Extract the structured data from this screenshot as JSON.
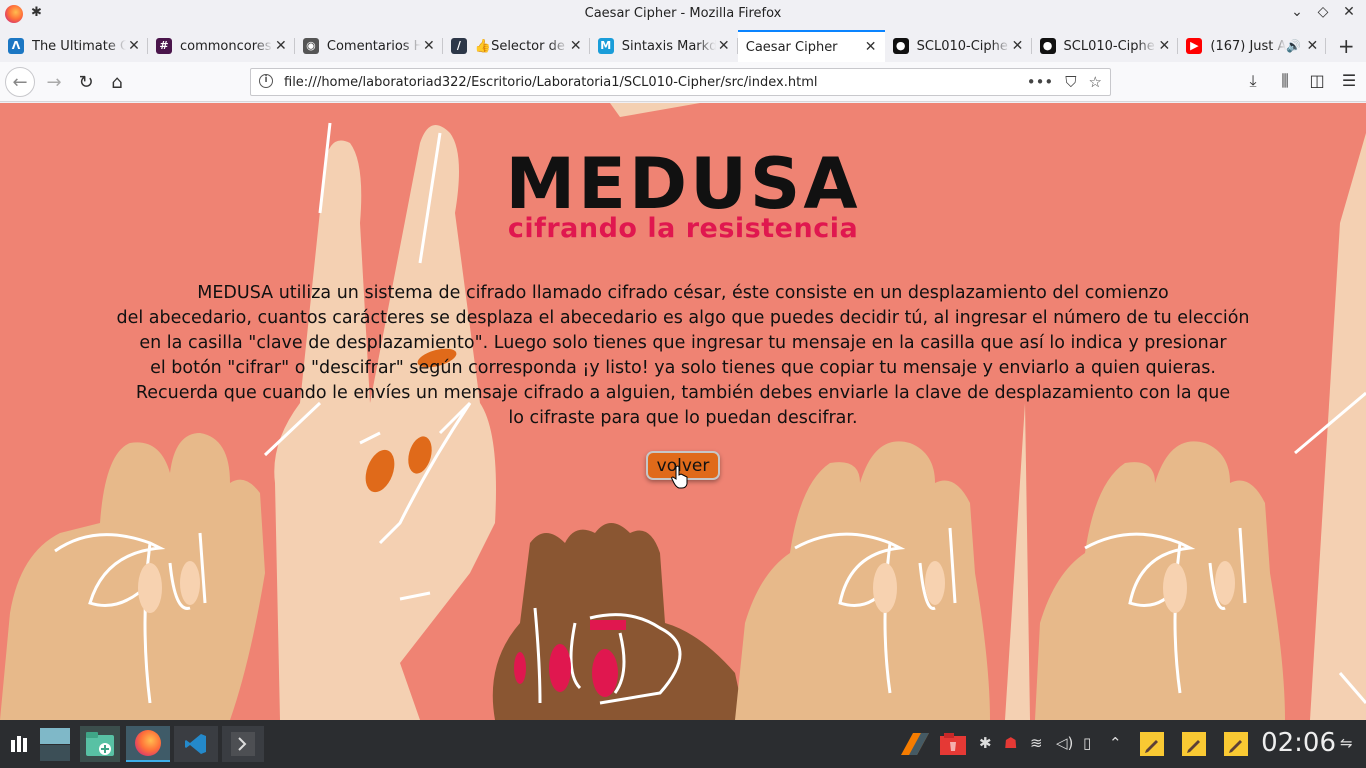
{
  "window": {
    "title": "Caesar Cipher - Mozilla Firefox"
  },
  "tabs": [
    {
      "label": "The Ultimate C",
      "icon": "ultimate-icon",
      "color": "#1c77c3",
      "glyph": "Λ"
    },
    {
      "label": "commoncores",
      "icon": "slack-icon",
      "color": "#4a154b",
      "glyph": "#"
    },
    {
      "label": "Comentarios H",
      "icon": "comments-icon",
      "color": "#555555",
      "glyph": "◉"
    },
    {
      "label": "Selector de",
      "icon": "emoji-selector-icon",
      "color": "#2d3748",
      "glyph": "∕",
      "prefix": "👍"
    },
    {
      "label": "Sintaxis Markd",
      "icon": "markdown-icon",
      "color": "#1a9dd9",
      "glyph": "M"
    },
    {
      "label": "Caesar Cipher",
      "icon": "",
      "color": "",
      "glyph": "",
      "active": true
    },
    {
      "label": "SCL010-Ciphe",
      "icon": "github-icon",
      "color": "#111111",
      "glyph": "●"
    },
    {
      "label": "SCL010-Ciphe",
      "icon": "github-icon",
      "color": "#111111",
      "glyph": "●"
    },
    {
      "label": "(167) Just A",
      "icon": "youtube-icon",
      "color": "#ff0000",
      "glyph": "▶",
      "audio": true
    }
  ],
  "navbar": {
    "url": "file:///home/laboratoriad322/Escritorio/Laboratoria1/SCL010-Cipher/src/index.html"
  },
  "page": {
    "title": "MEDUSA",
    "subtitle": "cifrando la resistencia",
    "description": [
      "MEDUSA utiliza un sistema de cifrado llamado cifrado césar, éste consiste en un desplazamiento del comienzo",
      "del abecedario, cuantos carácteres se desplaza el abecedario es algo que puedes decidir tú, al ingresar el número de tu elección",
      "en la casilla \"clave de desplazamiento\". Luego solo tienes que ingresar tu mensaje en la casilla que así lo indica y presionar",
      "el botón \"cifrar\" o \"descifrar\" según corresponda ¡y listo! ya solo tienes que copiar tu mensaje y enviarlo a quien quieras.",
      "Recuerda que cuando le envíes un mensaje cifrado a alguien, también debes enviarle la clave de desplazamiento con la que",
      "lo cifraste para que lo puedan descifrar."
    ],
    "button_label": "volver",
    "background_color": "#ef8373",
    "subtitle_color": "#e0174f",
    "button_color": "#e06a1a"
  },
  "taskbar": {
    "clock": "02:06"
  }
}
